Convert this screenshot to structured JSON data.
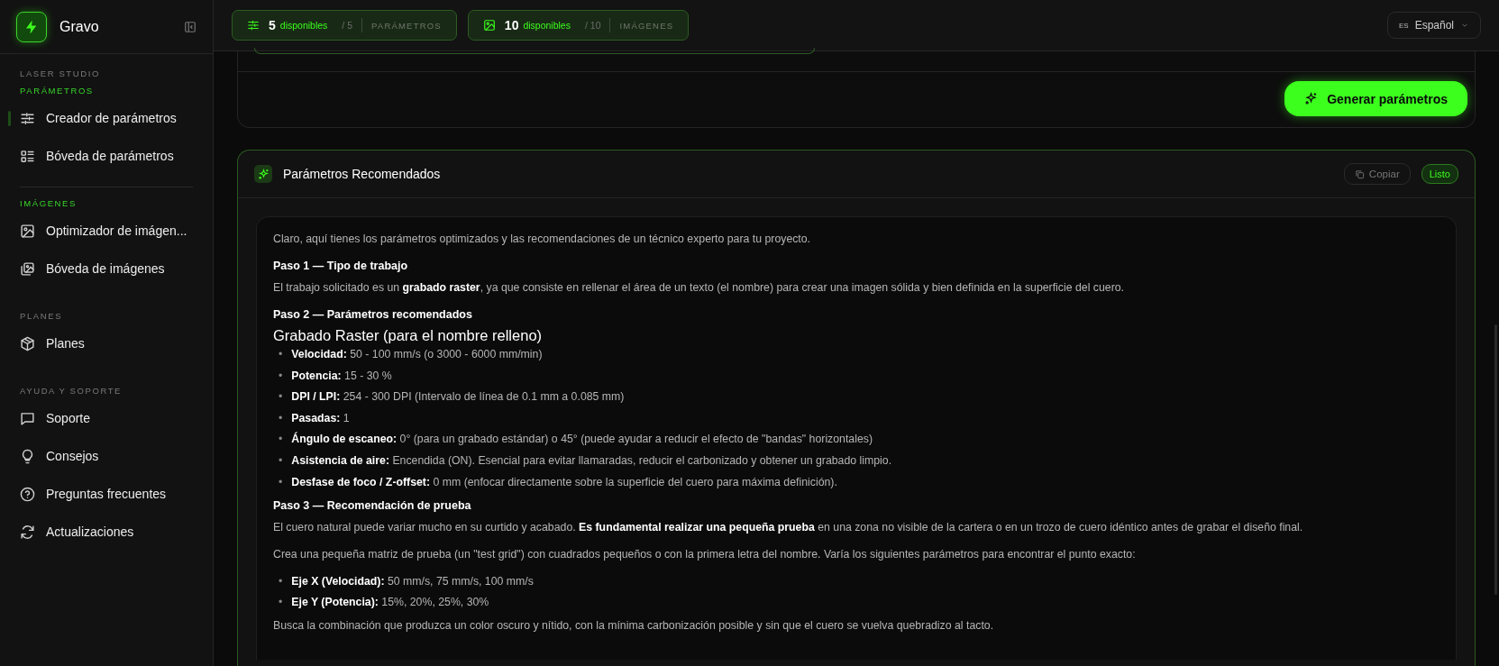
{
  "brand": {
    "name": "Gravo"
  },
  "sidebar": {
    "sections": [
      {
        "title": "LASER STUDIO",
        "accent": false
      },
      {
        "title": "PARÁMETROS",
        "accent": true,
        "items": [
          {
            "label": "Creador de parámetros",
            "selected": true
          },
          {
            "label": "Bóveda de parámetros",
            "selected": false
          }
        ]
      },
      {
        "title": "IMÁGENES",
        "accent": true,
        "divider": true,
        "items": [
          {
            "label": "Optimizador de imágen...",
            "selected": false
          },
          {
            "label": "Bóveda de imágenes",
            "selected": false
          }
        ]
      },
      {
        "title": "PLANES",
        "accent": false,
        "items": [
          {
            "label": "Planes",
            "selected": false
          }
        ]
      },
      {
        "title": "AYUDA Y SOPORTE",
        "accent": false,
        "items": [
          {
            "label": "Soporte",
            "selected": false
          },
          {
            "label": "Consejos",
            "selected": false
          },
          {
            "label": "Preguntas frecuentes",
            "selected": false
          },
          {
            "label": "Actualizaciones",
            "selected": false
          }
        ]
      }
    ]
  },
  "header": {
    "credits": [
      {
        "count": "5",
        "available": "disponibles",
        "total": "/ 5",
        "label": "PARÁMETROS"
      },
      {
        "count": "10",
        "available": "disponibles",
        "total": "/ 10",
        "label": "IMÁGENES"
      }
    ],
    "language": {
      "code": "ES",
      "label": "Español"
    }
  },
  "generate_button": {
    "label": "Generar parámetros"
  },
  "result": {
    "title": "Parámetros Recomendados",
    "copy_button": "Copiar",
    "status": "Listo",
    "content": [
      {
        "kind": "paragraph",
        "text": "Claro, aquí tienes los parámetros optimizados y las recomendaciones de un técnico experto para tu proyecto."
      },
      {
        "kind": "heading",
        "text": "Paso 1 — Tipo de trabajo"
      },
      {
        "kind": "paragraph",
        "text": "El trabajo solicitado es un **grabado raster**, ya que consiste en rellenar el área de un texto (el nombre) para crear una imagen sólida y bien definida en la superficie del cuero."
      },
      {
        "kind": "heading",
        "text": "Paso 2 — Parámetros recomendados"
      },
      {
        "kind": "subheading",
        "text": "Grabado Raster (para el nombre relleno)"
      },
      {
        "kind": "list",
        "items": [
          {
            "marker": "•",
            "text": "**Velocidad:** 50 - 100 mm/s (o 3000 - 6000 mm/min)"
          },
          {
            "marker": "•",
            "text": "**Potencia:** 15 - 30 %"
          },
          {
            "marker": "•",
            "text": "**DPI / LPI:** 254 - 300 DPI (Intervalo de línea de 0.1 mm a 0.085 mm)"
          },
          {
            "marker": "•",
            "text": "**Pasadas:** 1"
          },
          {
            "marker": "•",
            "text": "**Ángulo de escaneo:** 0° (para un grabado estándar) o 45° (puede ayudar a reducir el efecto de \"bandas\" horizontales)"
          },
          {
            "marker": "•",
            "text": "**Asistencia de aire:** Encendida (ON). Esencial para evitar llamaradas, reducir el carbonizado y obtener un grabado limpio."
          },
          {
            "marker": "•",
            "text": "**Desfase de foco / Z-offset:** 0 mm (enfocar directamente sobre la superficie del cuero para máxima definición)."
          }
        ]
      },
      {
        "kind": "heading",
        "text": "Paso 3 — Recomendación de prueba"
      },
      {
        "kind": "paragraph",
        "text": "El cuero natural puede variar mucho en su curtido y acabado. **Es fundamental realizar una pequeña prueba** en una zona no visible de la cartera o en un trozo de cuero idéntico antes de grabar el diseño final."
      },
      {
        "kind": "paragraph",
        "text": "Crea una pequeña matriz de prueba (un \"test grid\") con cuadrados pequeños o con la primera letra del nombre. Varía los siguientes parámetros para encontrar el punto exacto:"
      },
      {
        "kind": "list",
        "items": [
          {
            "marker": "•",
            "text": "**Eje X (Velocidad):** 50 mm/s, 75 mm/s, 100 mm/s"
          },
          {
            "marker": "•",
            "text": "**Eje Y (Potencia):** 15%, 20%, 25%, 30%"
          }
        ]
      },
      {
        "kind": "paragraph",
        "text": "Busca la combinación que produzca un color oscuro y nítido, con la mínima carbonización posible y sin que el cuero se vuelva quebradizo al tacto."
      }
    ]
  }
}
